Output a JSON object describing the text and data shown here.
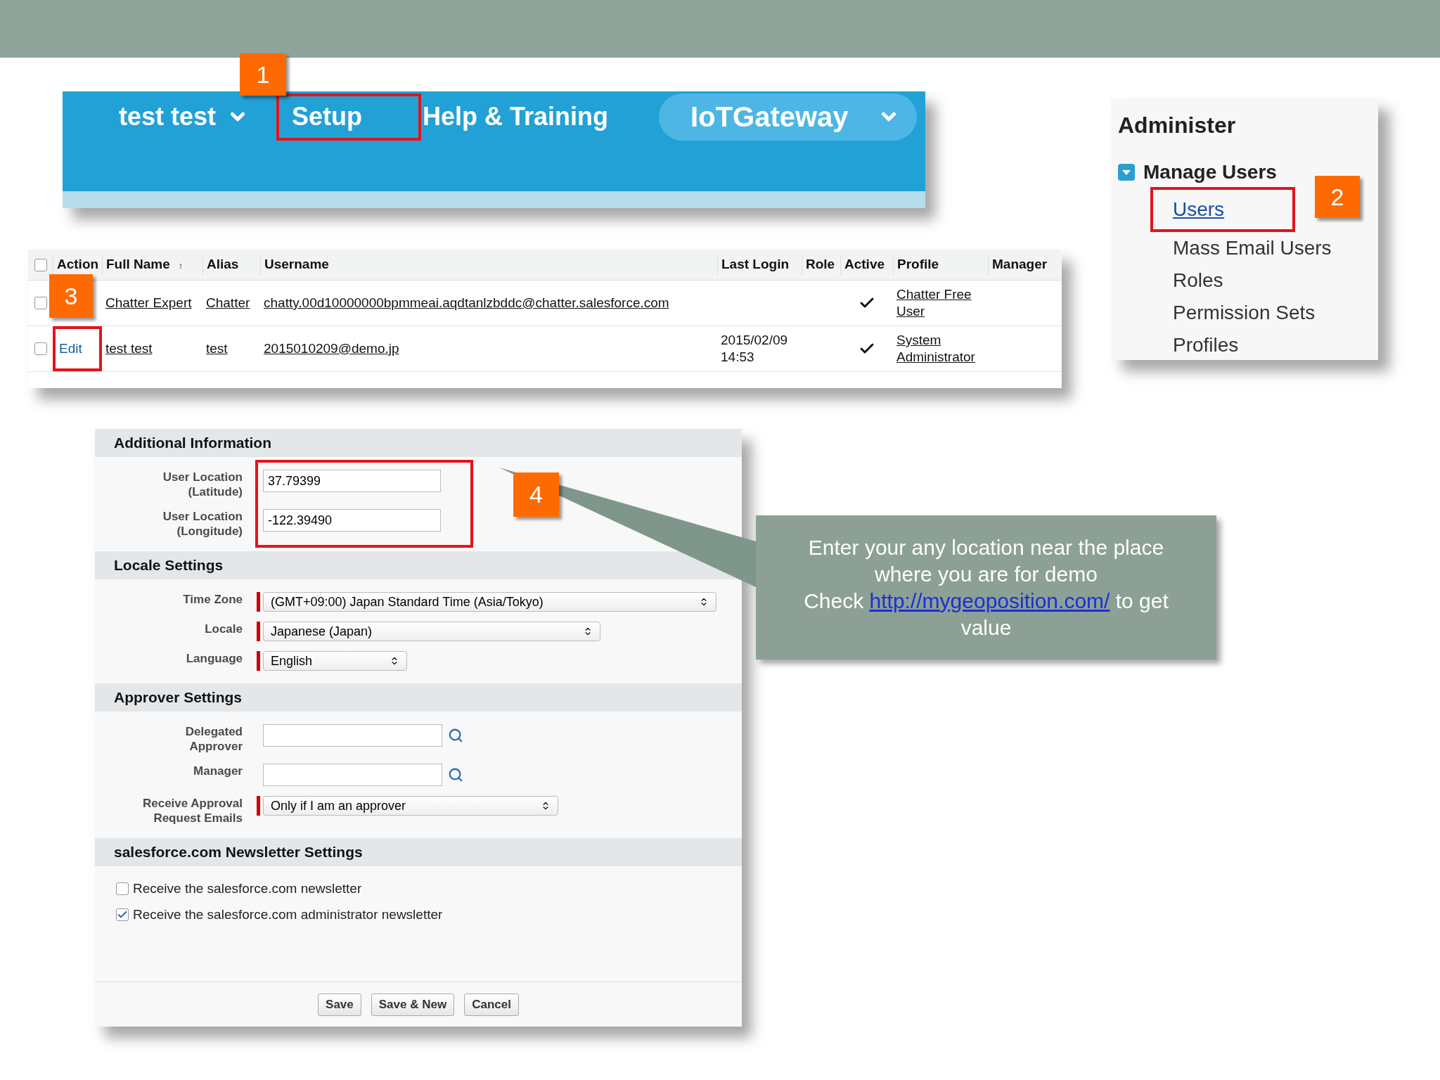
{
  "nav": {
    "user_menu": "test test",
    "tabs": [
      {
        "label": "Setup",
        "highlighted": true
      },
      {
        "label": "Help & Training",
        "highlighted": false
      }
    ],
    "app_menu": "IoTGateway",
    "step": "1"
  },
  "administer": {
    "title": "Administer",
    "group": {
      "label": "Manage Users",
      "expanded": true
    },
    "items": [
      {
        "label": "Users",
        "link": true,
        "highlighted": true
      },
      {
        "label": "Mass Email Users",
        "link": false,
        "highlighted": false
      },
      {
        "label": "Roles",
        "link": false,
        "highlighted": false
      },
      {
        "label": "Permission Sets",
        "link": false,
        "highlighted": false
      },
      {
        "label": "Profiles",
        "link": false,
        "highlighted": false
      }
    ],
    "step": "2"
  },
  "users_table": {
    "select_all_checked": false,
    "columns": [
      {
        "label": "Action"
      },
      {
        "label": "Full Name",
        "sort": "↑"
      },
      {
        "label": "Alias"
      },
      {
        "label": "Username"
      },
      {
        "label": "Last Login"
      },
      {
        "label": "Role"
      },
      {
        "label": "Active"
      },
      {
        "label": "Profile"
      },
      {
        "label": "Manager"
      }
    ],
    "rows": [
      {
        "checked": false,
        "full_name": "Chatter Expert",
        "alias": "Chatter",
        "username": "chatty.00d10000000bpmmeai.aqdtanlzbddc@chatter.salesforce.com",
        "active": true,
        "profile": "Chatter Free User"
      },
      {
        "checked": false,
        "action": "Edit",
        "action_highlighted": true,
        "full_name": "test test",
        "alias": "test",
        "username": "2015010209@demo.jp",
        "last_login": "2015/02/09 14:53",
        "active": true,
        "profile": "System Administrator"
      }
    ],
    "step": "3"
  },
  "user_form": {
    "sections": [
      {
        "title": "Additional Information",
        "highlighted": true,
        "fields": [
          {
            "kind": "text",
            "label": "User Location (Latitude)",
            "value": "37.79399",
            "required": false
          },
          {
            "kind": "text",
            "label": "User Location (Longitude)",
            "value": "-122.39490",
            "required": false
          }
        ]
      },
      {
        "title": "Locale Settings",
        "fields": [
          {
            "kind": "select",
            "label": "Time Zone",
            "value": "(GMT+09:00) Japan Standard Time (Asia/Tokyo)",
            "required": true
          },
          {
            "kind": "select",
            "label": "Locale",
            "value": "Japanese (Japan)",
            "required": true
          },
          {
            "kind": "select",
            "label": "Language",
            "value": "English",
            "required": true
          }
        ]
      },
      {
        "title": "Approver Settings",
        "fields": [
          {
            "kind": "lookup",
            "label": "Delegated Approver",
            "required": false
          },
          {
            "kind": "lookup",
            "label": "Manager",
            "required": false
          },
          {
            "kind": "select",
            "label": "Receive Approval Request Emails",
            "value": "Only if I am an approver",
            "required": true
          }
        ]
      },
      {
        "title": "salesforce.com Newsletter Settings",
        "checkboxes": [
          {
            "label": "Receive the salesforce.com newsletter",
            "checked": false
          },
          {
            "label": "Receive the salesforce.com administrator newsletter",
            "checked": true
          }
        ]
      }
    ],
    "buttons": [
      "Save",
      "Save & New",
      "Cancel"
    ],
    "step": "4"
  },
  "callout": {
    "text": "Enter your any location near the place where you are for demo",
    "link_prefix": "Check ",
    "link": "http://mygeoposition.com/",
    "link_suffix": " to get value"
  }
}
